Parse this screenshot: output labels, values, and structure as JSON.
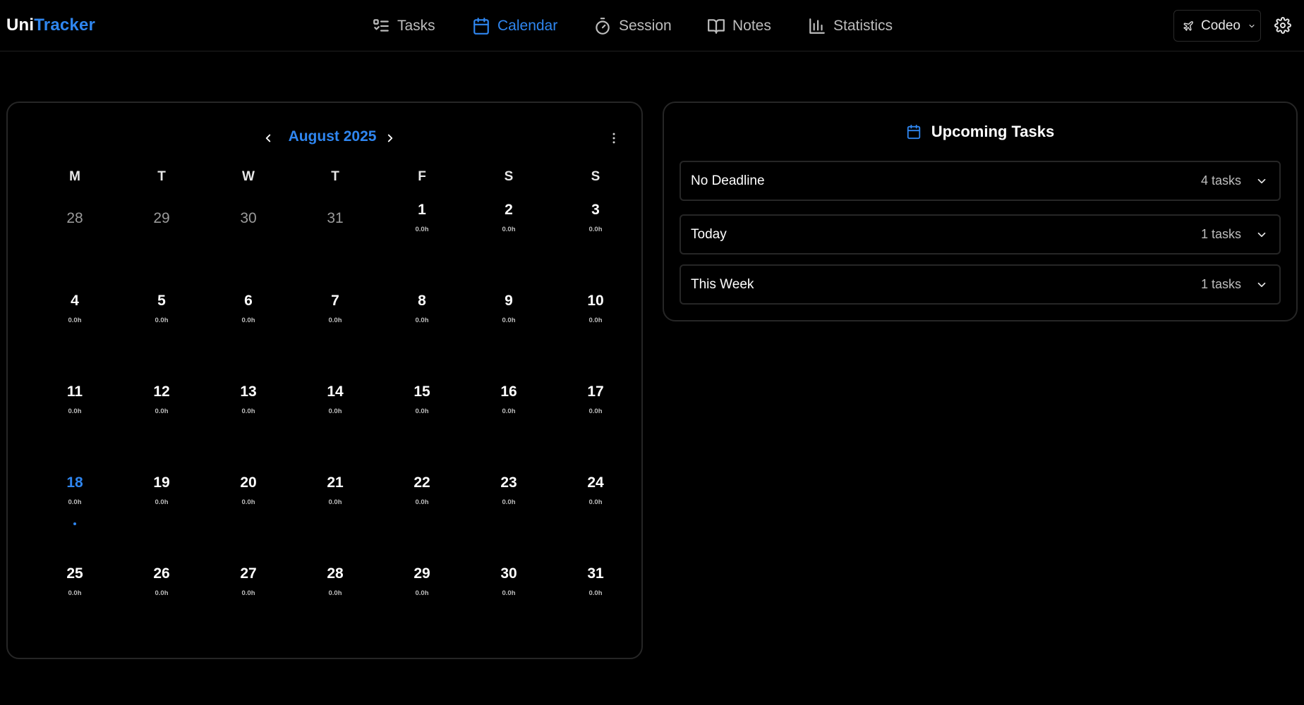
{
  "brand": {
    "part1": "Uni",
    "part2": "Tracker"
  },
  "nav": [
    {
      "label": "Tasks",
      "icon": "checklist-icon",
      "active": false
    },
    {
      "label": "Calendar",
      "icon": "calendar-icon",
      "active": true
    },
    {
      "label": "Session",
      "icon": "stopwatch-icon",
      "active": false
    },
    {
      "label": "Notes",
      "icon": "book-icon",
      "active": false
    },
    {
      "label": "Statistics",
      "icon": "bar-chart-icon",
      "active": false
    }
  ],
  "workspace": {
    "label": "Codeo"
  },
  "calendar": {
    "month_label": "August 2025",
    "weekdays": [
      "M",
      "T",
      "W",
      "T",
      "F",
      "S",
      "S"
    ],
    "leading_days": [
      "28",
      "29",
      "30",
      "31"
    ],
    "days": [
      {
        "n": "1",
        "h": "0.0h"
      },
      {
        "n": "2",
        "h": "0.0h"
      },
      {
        "n": "3",
        "h": "0.0h"
      },
      {
        "n": "4",
        "h": "0.0h"
      },
      {
        "n": "5",
        "h": "0.0h"
      },
      {
        "n": "6",
        "h": "0.0h"
      },
      {
        "n": "7",
        "h": "0.0h"
      },
      {
        "n": "8",
        "h": "0.0h"
      },
      {
        "n": "9",
        "h": "0.0h"
      },
      {
        "n": "10",
        "h": "0.0h"
      },
      {
        "n": "11",
        "h": "0.0h"
      },
      {
        "n": "12",
        "h": "0.0h"
      },
      {
        "n": "13",
        "h": "0.0h"
      },
      {
        "n": "14",
        "h": "0.0h"
      },
      {
        "n": "15",
        "h": "0.0h"
      },
      {
        "n": "16",
        "h": "0.0h"
      },
      {
        "n": "17",
        "h": "0.0h"
      },
      {
        "n": "18",
        "h": "0.0h",
        "today": true
      },
      {
        "n": "19",
        "h": "0.0h"
      },
      {
        "n": "20",
        "h": "0.0h"
      },
      {
        "n": "21",
        "h": "0.0h"
      },
      {
        "n": "22",
        "h": "0.0h"
      },
      {
        "n": "23",
        "h": "0.0h"
      },
      {
        "n": "24",
        "h": "0.0h"
      },
      {
        "n": "25",
        "h": "0.0h"
      },
      {
        "n": "26",
        "h": "0.0h"
      },
      {
        "n": "27",
        "h": "0.0h"
      },
      {
        "n": "28",
        "h": "0.0h"
      },
      {
        "n": "29",
        "h": "0.0h"
      },
      {
        "n": "30",
        "h": "0.0h"
      },
      {
        "n": "31",
        "h": "0.0h"
      }
    ]
  },
  "upcoming": {
    "title": "Upcoming Tasks",
    "groups": [
      {
        "label": "No Deadline",
        "count": "4 tasks"
      },
      {
        "label": "Today",
        "count": "1 tasks"
      },
      {
        "label": "This Week",
        "count": "1 tasks"
      }
    ]
  },
  "colors": {
    "accent": "#2f86f0",
    "background": "#000000",
    "border": "#262626"
  }
}
